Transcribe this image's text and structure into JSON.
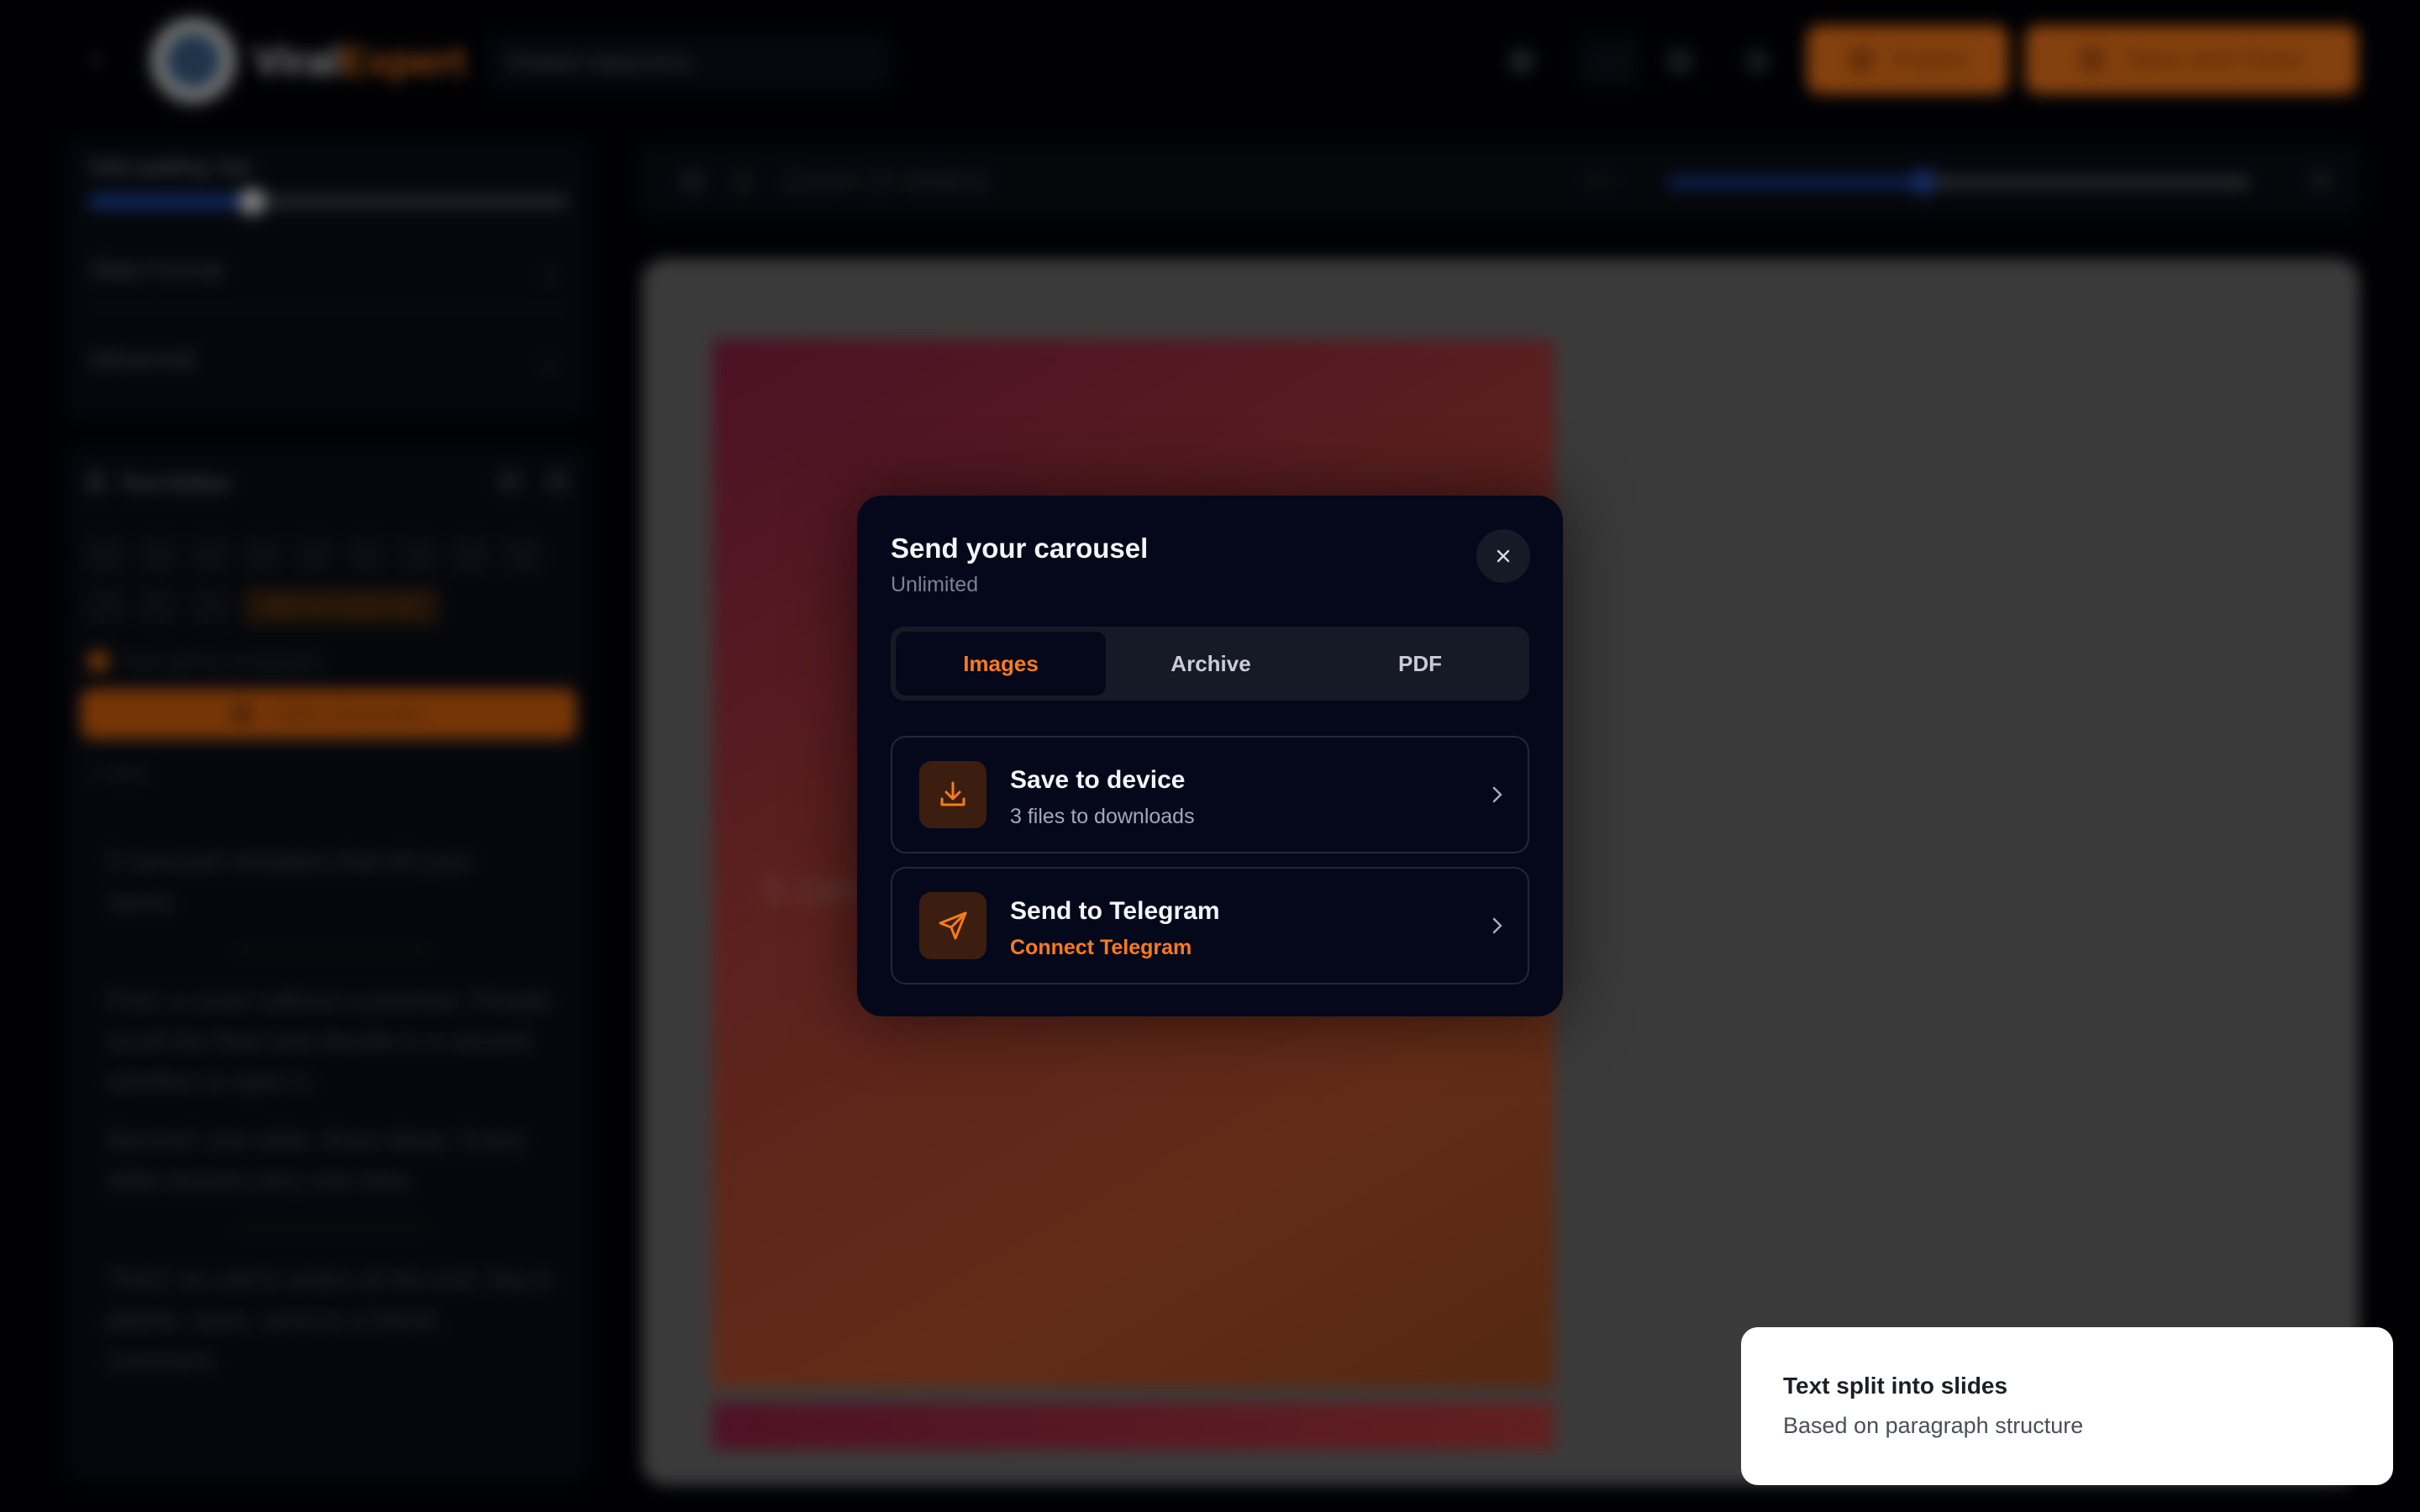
{
  "header": {
    "brand_a": "Viral",
    "brand_b": "Expert",
    "project_name": "Новая карусель",
    "export_label": "Export",
    "save_label": "Save and Close"
  },
  "sidebar": {
    "section_label": "Safe padding: 0px",
    "padding_fraction": 0.34,
    "slide_format_label": "Slide Format",
    "advanced_label": "Advanced",
    "text_editor_label": "Text Editor",
    "split_label": "Split into slides (AI)",
    "auto_split_label": "Auto-split by paragraphs",
    "generate_label": "Apply (Generate)",
    "slides_count": "3 slides",
    "paragraphs": [
      "5 carousel mistakes that kill your saves",
      "First: a cover without a promise. People scroll the feed and decide in a second whether to open it.",
      "Second: one slide, three ideas. Every slide should carry one idea.",
      "Third: no call to action at the end. Say it plainly: save, send to a friend, comment."
    ]
  },
  "canvas": {
    "title": "Zoom (3 slides)",
    "zoom_label": "36%",
    "zoom_fraction": 0.44,
    "slide_text": "5 carousel"
  },
  "modal": {
    "title": "Send your carousel",
    "subtitle": "Unlimited",
    "tabs": [
      "Images",
      "Archive",
      "PDF"
    ],
    "active_tab": 0,
    "options": [
      {
        "title": "Save to device",
        "subtitle": "3 files to downloads",
        "icon": "download-icon"
      },
      {
        "title": "Send to Telegram",
        "subtitle": "Connect Telegram",
        "icon": "send-icon"
      }
    ]
  },
  "toast": {
    "title": "Text split into slides",
    "description": "Based on paragraph structure"
  },
  "colors": {
    "accent": "#f97a1c",
    "modal_bg": "#05081a",
    "icon_tile": "#3b1e10"
  }
}
